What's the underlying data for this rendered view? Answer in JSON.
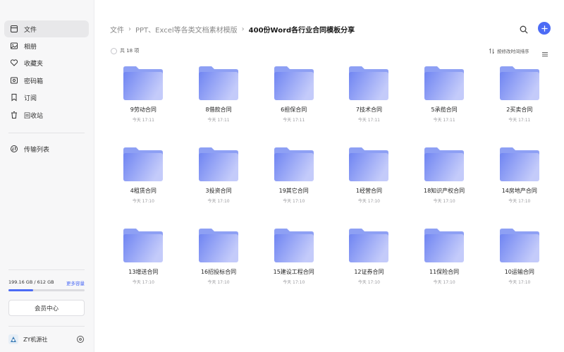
{
  "sidebar": {
    "items": [
      {
        "label": "文件",
        "icon": "file-icon",
        "active": true
      },
      {
        "label": "相册",
        "icon": "photo-icon"
      },
      {
        "label": "收藏夹",
        "icon": "heart-icon"
      },
      {
        "label": "密码箱",
        "icon": "vault-icon"
      },
      {
        "label": "订阅",
        "icon": "bookmark-icon"
      },
      {
        "label": "回收站",
        "icon": "trash-icon"
      },
      {
        "label": "传输列表",
        "icon": "transfer-icon"
      }
    ],
    "storage": {
      "used_text": "199.16 GB / 612 GB",
      "used_fraction": 0.325,
      "upgrade_label": "更多容量"
    },
    "vip_label": "会员中心",
    "user": {
      "name": "ZY机源社"
    }
  },
  "header": {
    "breadcrumb": [
      "文件",
      "PPT、Excel等各类文档素材模版",
      "400份Word各行业合同模板分享"
    ]
  },
  "toolbar": {
    "count_label": "共 18 项",
    "sort_label": "按修改时间排序"
  },
  "files": [
    {
      "name": "9劳动合同",
      "date": "今天 17:11"
    },
    {
      "name": "8借款合同",
      "date": "今天 17:11"
    },
    {
      "name": "6担保合同",
      "date": "今天 17:11"
    },
    {
      "name": "7技术合同",
      "date": "今天 17:11"
    },
    {
      "name": "5承揽合同",
      "date": "今天 17:11"
    },
    {
      "name": "2买卖合同",
      "date": "今天 17:11"
    },
    {
      "name": "4租赁合同",
      "date": "今天 17:10"
    },
    {
      "name": "3投资合同",
      "date": "今天 17:10"
    },
    {
      "name": "19其它合同",
      "date": "今天 17:10"
    },
    {
      "name": "1经营合同",
      "date": "今天 17:10"
    },
    {
      "name": "18知识产权合同",
      "date": "今天 17:10"
    },
    {
      "name": "14房地产合同",
      "date": "今天 17:10"
    },
    {
      "name": "13增送合同",
      "date": "今天 17:10"
    },
    {
      "name": "16招投标合同",
      "date": "今天 17:10"
    },
    {
      "name": "15建设工程合同",
      "date": "今天 17:10"
    },
    {
      "name": "12证券合同",
      "date": "今天 17:10"
    },
    {
      "name": "11保险合同",
      "date": "今天 17:10"
    },
    {
      "name": "10运输合同",
      "date": "今天 17:10"
    }
  ],
  "colors": {
    "accent": "#4c6bf5",
    "folder_light": "#c9d0fb",
    "folder_dark": "#7b8ff2"
  }
}
